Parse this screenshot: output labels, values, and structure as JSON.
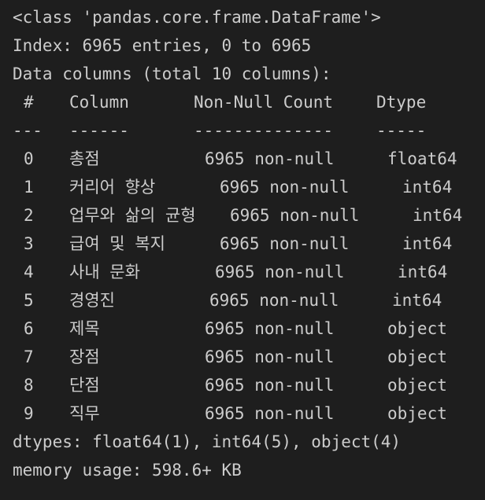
{
  "output": {
    "class_line": "<class 'pandas.core.frame.DataFrame'>",
    "index_line": "Index: 6965 entries, 0 to 6965",
    "columns_line": "Data columns (total 10 columns):",
    "headers": {
      "num": "#",
      "column": "Column",
      "count": "Non-Null Count",
      "dtype": "Dtype"
    },
    "separators": {
      "num": "---",
      "column": "------",
      "count": "--------------",
      "dtype": "-----"
    },
    "rows": [
      {
        "num": "0",
        "column": "총점",
        "count": "6965 non-null",
        "dtype": "float64"
      },
      {
        "num": "1",
        "column": "커리어 향상",
        "count": "6965 non-null",
        "dtype": "int64"
      },
      {
        "num": "2",
        "column": "업무와 삶의 균형",
        "count": "6965 non-null",
        "dtype": "int64"
      },
      {
        "num": "3",
        "column": "급여 및 복지",
        "count": "6965 non-null",
        "dtype": "int64"
      },
      {
        "num": "4",
        "column": "사내 문화",
        "count": "6965 non-null",
        "dtype": "int64"
      },
      {
        "num": "5",
        "column": "경영진",
        "count": "6965 non-null",
        "dtype": "int64"
      },
      {
        "num": "6",
        "column": "제목",
        "count": "6965 non-null",
        "dtype": "object"
      },
      {
        "num": "7",
        "column": "장점",
        "count": "6965 non-null",
        "dtype": "object"
      },
      {
        "num": "8",
        "column": "단점",
        "count": "6965 non-null",
        "dtype": "object"
      },
      {
        "num": "9",
        "column": "직무",
        "count": "6965 non-null",
        "dtype": "object"
      }
    ],
    "dtypes_line": "dtypes: float64(1), int64(5), object(4)",
    "memory_line": "memory usage: 598.6+ KB"
  }
}
